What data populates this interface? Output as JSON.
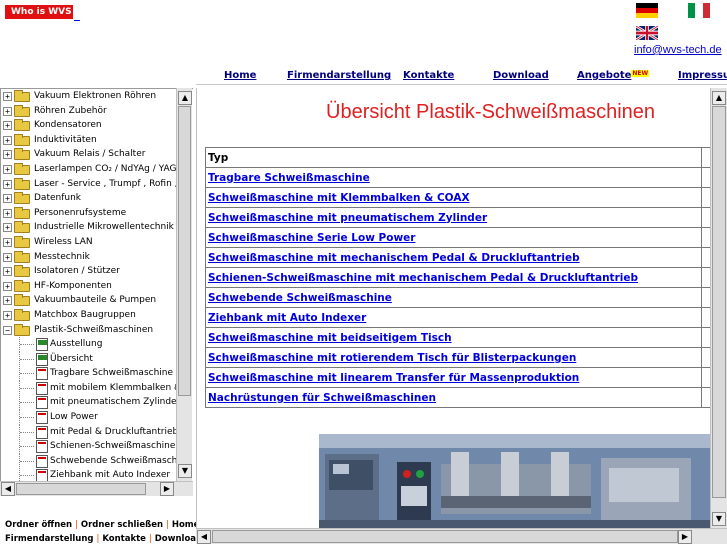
{
  "header": {
    "who_is_label": "Who is WVS",
    "email": "info@wvs-tech.de",
    "flags": [
      "flag-de",
      "flag-it",
      "flag-uk"
    ]
  },
  "nav": {
    "items": [
      {
        "label": "Home"
      },
      {
        "label": "Firmendarstellung"
      },
      {
        "label": "Kontakte"
      },
      {
        "label": "Download"
      },
      {
        "label": "Angebote",
        "badge": "NEW"
      },
      {
        "label": "Impressum"
      }
    ]
  },
  "tree": {
    "folders": [
      {
        "label": "Vakuum Elektronen Röhren",
        "expander": "+"
      },
      {
        "label": "Röhren Zubehör",
        "expander": "+"
      },
      {
        "label": "Kondensatoren",
        "expander": "+"
      },
      {
        "label": "Induktivitäten",
        "expander": "+"
      },
      {
        "label": "Vakuum Relais / Schalter",
        "expander": "+"
      },
      {
        "label": "Laserlampen CO₂ / NdYAg / YAG",
        "expander": "+"
      },
      {
        "label": "Laser - Service , Trumpf , Rofin ,",
        "expander": "+"
      },
      {
        "label": "Datenfunk",
        "expander": "+"
      },
      {
        "label": "Personenrufsysteme",
        "expander": "+"
      },
      {
        "label": "Industrielle Mikrowellentechnik",
        "expander": "+"
      },
      {
        "label": "Wireless LAN",
        "expander": "+"
      },
      {
        "label": "Messtechnik",
        "expander": "+"
      },
      {
        "label": "Isolatoren / Stützer",
        "expander": "+"
      },
      {
        "label": "HF-Komponenten",
        "expander": "+"
      },
      {
        "label": "Vakuumbauteile & Pumpen",
        "expander": "+"
      },
      {
        "label": "Matchbox Baugruppen",
        "expander": "+"
      },
      {
        "label": "Plastik-Schweißmaschinen",
        "expander": "−"
      }
    ],
    "children": [
      {
        "label": "Ausstellung",
        "icon": "green"
      },
      {
        "label": "Übersicht",
        "icon": "green"
      },
      {
        "label": "Tragbare Schweißmaschine",
        "icon": "red"
      },
      {
        "label": "mit mobilem Klemmbalken & C",
        "icon": "red"
      },
      {
        "label": "mit pneumatischem Zylinder",
        "icon": "red"
      },
      {
        "label": "Low Power",
        "icon": "red"
      },
      {
        "label": "mit Pedal & Druckluftantrieb",
        "icon": "red"
      },
      {
        "label": "Schienen-Schweißmaschine",
        "icon": "red"
      },
      {
        "label": "Schwebende Schweißmasch",
        "icon": "red"
      },
      {
        "label": "Ziehbank mit Auto Indexer",
        "icon": "red"
      }
    ],
    "footer": {
      "line1": [
        "Ordner öffnen",
        "Ordner schließen",
        "Home"
      ],
      "line2": [
        "Firmendarstellung",
        "Kontakte",
        "Download"
      ],
      "separator": "|"
    }
  },
  "main": {
    "title": "Übersicht Plastik-Schweißmaschinen",
    "table_header": "Typ",
    "rows": [
      "Tragbare Schweißmaschine",
      "Schweißmaschine mit Klemmbalken & COAX",
      "Schweißmaschine mit pneumatischem Zylinder",
      "Schweißmaschine Serie Low Power",
      "Schweißmaschine mit mechanischem Pedal & Druckluftantrieb",
      "Schienen-Schweißmaschine mit mechanischem Pedal & Druckluftantrieb",
      "Schwebende Schweißmaschine",
      "Ziehbank mit Auto Indexer",
      "Schweißmaschine mit beidseitigem Tisch",
      "Schweißmaschine mit rotierendem Tisch für Blisterpackungen",
      "Schweißmaschine mit linearem Transfer für Massenproduktion",
      "Nachrüstungen für Schweißmaschinen"
    ]
  },
  "colors": {
    "title_red": "#e02020",
    "link_blue": "#0000dd",
    "nav_navy": "#000080",
    "footer_separator": "#e05000",
    "who_button": "#e01010"
  }
}
